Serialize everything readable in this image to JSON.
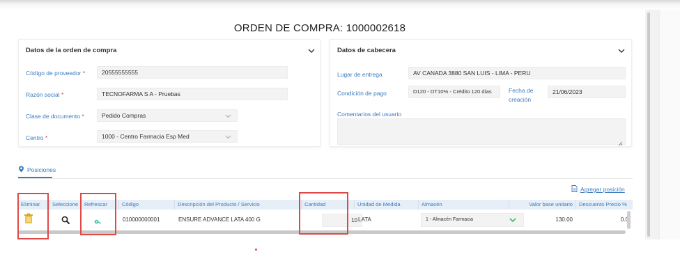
{
  "page": {
    "title": "ORDEN DE COMPRA: 1000002618"
  },
  "colors": {
    "accent": "#3a7bbf",
    "required": "#e03b3b",
    "highlight": "#e04848",
    "header_bg": "#e6eef7"
  },
  "datos_orden": {
    "title": "Datos de la orden de compra",
    "fields": {
      "codigo_proveedor": {
        "label": "Código de proveedor",
        "required_mark": "*",
        "value": "20555555555"
      },
      "razon_social": {
        "label": "Razón social",
        "required_mark": "*",
        "value": "TECNOFARMA S A - Pruebas"
      },
      "clase_documento": {
        "label": "Clase de documento",
        "required_mark": "*",
        "value": "Pedido Compras"
      },
      "centro": {
        "label": "Centro",
        "required_mark": "*",
        "value": "1000 - Centro Farmacia Esp Med"
      }
    }
  },
  "datos_cabecera": {
    "title": "Datos de cabecera",
    "fields": {
      "lugar_entrega": {
        "label": "Lugar de entrega",
        "value": "AV CANADA  3880 SAN LUIS - LIMA - PERU"
      },
      "condicion_pago": {
        "label": "Condición de pago",
        "value": "D120 - DT10% - Crédito 120 días"
      },
      "fecha_creacion": {
        "label_line1": "Fecha de",
        "label_line2": "creación",
        "value": "21/06/2023"
      },
      "comentarios": {
        "label": "Comentarios del usuario",
        "value": ""
      }
    }
  },
  "tabs": {
    "posiciones": "Posiciones"
  },
  "actions": {
    "agregar_posicion": "Agregar posición"
  },
  "table": {
    "headers": {
      "eliminar": "Eliminar",
      "seleccione": "Seleccione",
      "refrescar": "Refrescar",
      "codigo": "Código",
      "descripcion": "Descripción del Producto / Servicio",
      "cantidad": "Cantidad",
      "unidad": "Unidad de Medida",
      "almacen": "Almacén",
      "valor_base": "Valor base unitario",
      "descuento": "Descuento Precio %"
    },
    "rows": [
      {
        "codigo": "010000000001",
        "descripcion": "ENSURE ADVANCE LATA 400 G",
        "cantidad": "10",
        "unidad": "LATA",
        "almacen": "1 - Almacén Farmacia",
        "valor_base": "130.00",
        "descuento": "0.0"
      }
    ]
  },
  "icons": {
    "delete": "trash-icon",
    "select": "magnifier-icon",
    "refresh": "refresh-icon",
    "posiciones": "location-pin-icon",
    "add": "document-icon",
    "expand": "chevron-down-icon"
  }
}
